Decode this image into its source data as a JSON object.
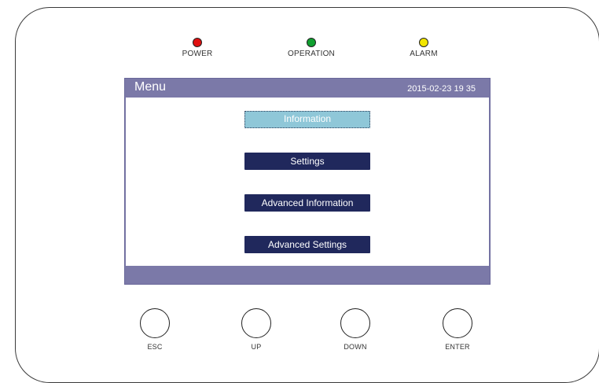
{
  "leds": [
    {
      "label": "POWER",
      "color": "#e01010"
    },
    {
      "label": "OPERATION",
      "color": "#10a030"
    },
    {
      "label": "ALARM",
      "color": "#f2e600"
    }
  ],
  "screen": {
    "title": "Menu",
    "datetime": "2015-02-23  19 35",
    "menu_items": [
      {
        "label": "Information",
        "selected": true
      },
      {
        "label": "Settings",
        "selected": false
      },
      {
        "label": "Advanced Information",
        "selected": false
      },
      {
        "label": "Advanced Settings",
        "selected": false
      }
    ]
  },
  "buttons": [
    {
      "label": "ESC"
    },
    {
      "label": "UP"
    },
    {
      "label": "DOWN"
    },
    {
      "label": "ENTER"
    }
  ]
}
